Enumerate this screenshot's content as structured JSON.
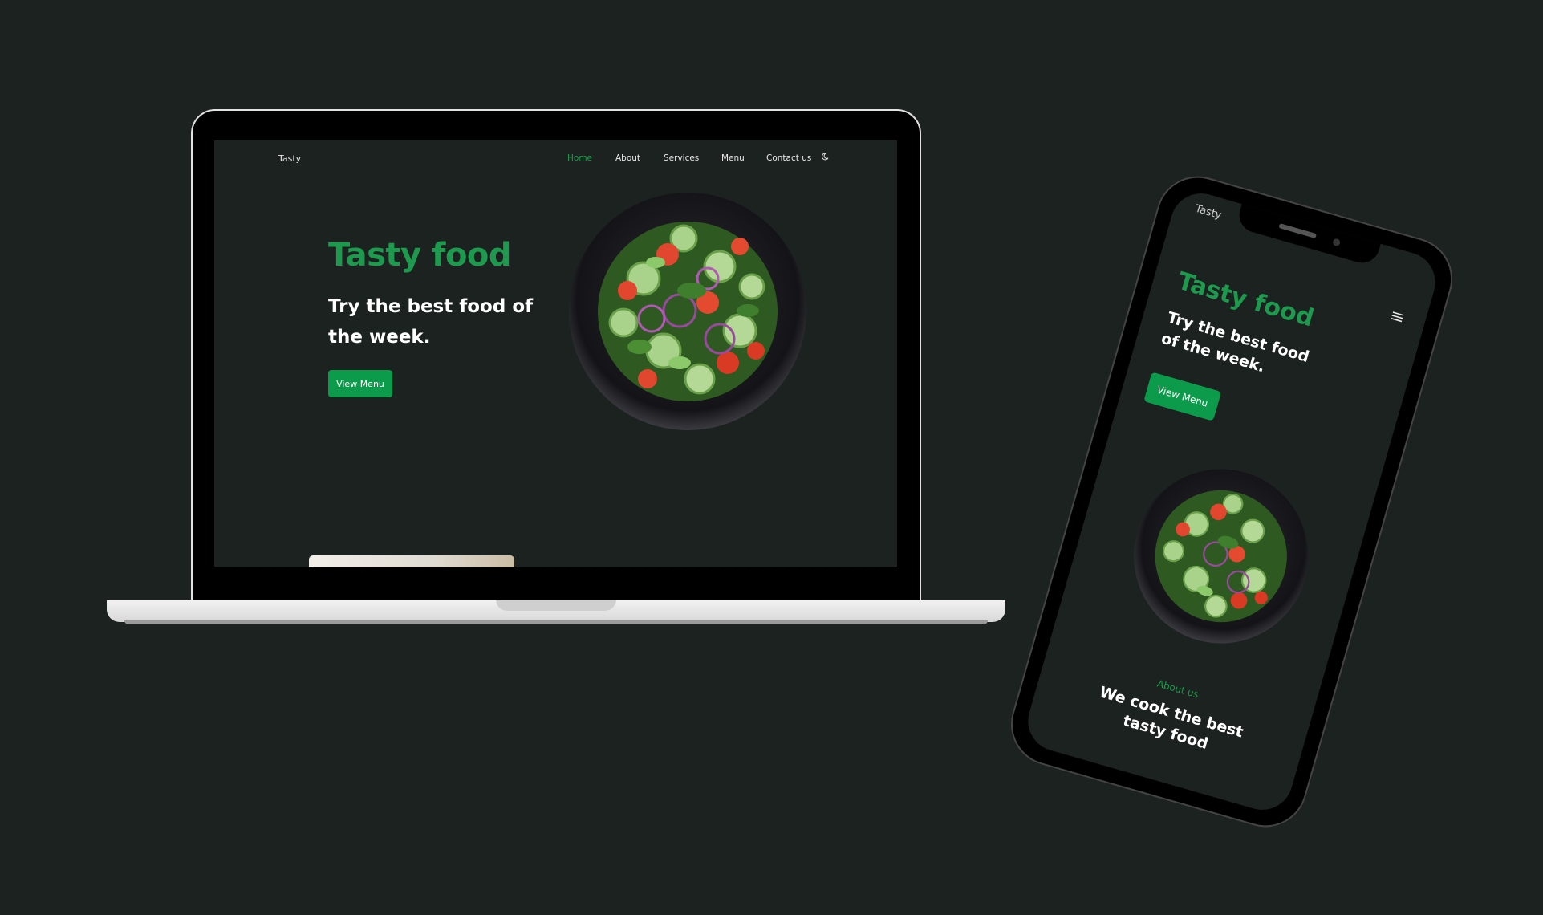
{
  "desktop": {
    "brand": "Tasty",
    "nav": [
      {
        "label": "Home",
        "active": true
      },
      {
        "label": "About"
      },
      {
        "label": "Services"
      },
      {
        "label": "Menu"
      },
      {
        "label": "Contact us"
      }
    ],
    "theme_toggle_icon": "moon-icon",
    "hero": {
      "title": "Tasty food",
      "subtitle": "Try the best food of the week.",
      "button": "View Menu"
    }
  },
  "mobile": {
    "brand": "Tasty",
    "menu_icon": "hamburger-icon",
    "hero": {
      "title": "Tasty food",
      "subtitle": "Try the best food of the week.",
      "button": "View Menu"
    },
    "about": {
      "label": "About us",
      "heading_line1": "We cook the best",
      "heading_line2": "tasty food"
    }
  },
  "colors": {
    "background": "#1c221f",
    "accent": "#1d9a4e",
    "button": "#0c9a4b"
  }
}
